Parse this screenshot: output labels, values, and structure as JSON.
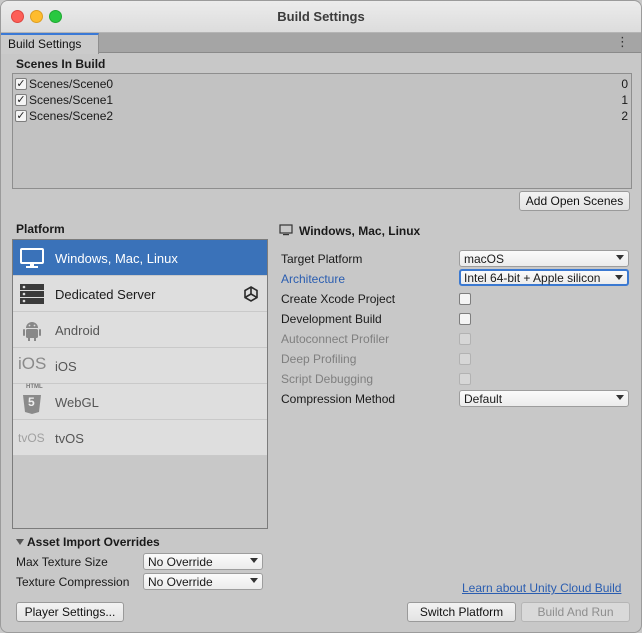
{
  "window": {
    "title": "Build Settings"
  },
  "tab": {
    "label": "Build Settings"
  },
  "scenes": {
    "header": "Scenes In Build",
    "items": [
      {
        "name": "Scenes/Scene0",
        "index": "0",
        "checked": true
      },
      {
        "name": "Scenes/Scene1",
        "index": "1",
        "checked": true
      },
      {
        "name": "Scenes/Scene2",
        "index": "2",
        "checked": true
      }
    ],
    "add_open_scenes_label": "Add Open Scenes"
  },
  "platform": {
    "header": "Platform",
    "items": [
      {
        "label": "Windows, Mac, Linux",
        "icon": "monitor-icon",
        "selected": true
      },
      {
        "label": "Dedicated Server",
        "icon": "server-icon",
        "selected": false,
        "badge": "unity-icon"
      },
      {
        "label": "Android",
        "icon": "android-icon",
        "selected": false
      },
      {
        "label": "iOS",
        "icon": "ios-icon",
        "icon_text": "iOS",
        "selected": false
      },
      {
        "label": "WebGL",
        "icon": "html5-icon",
        "icon_text": "5",
        "icon_caption": "HTML",
        "selected": false
      },
      {
        "label": "tvOS",
        "icon": "tvos-icon",
        "icon_text": "tvOS",
        "selected": false
      }
    ]
  },
  "settings": {
    "title": "Windows, Mac, Linux",
    "target_platform_label": "Target Platform",
    "target_platform_value": "macOS",
    "architecture_label": "Architecture",
    "architecture_value": "Intel 64-bit + Apple silicon",
    "create_xcode_label": "Create Xcode Project",
    "development_build_label": "Development Build",
    "autoconnect_profiler_label": "Autoconnect Profiler",
    "deep_profiling_label": "Deep Profiling",
    "script_debugging_label": "Script Debugging",
    "compression_method_label": "Compression Method",
    "compression_method_value": "Default"
  },
  "asset_import": {
    "header": "Asset Import Overrides",
    "max_texture_size_label": "Max Texture Size",
    "max_texture_size_value": "No Override",
    "texture_compression_label": "Texture Compression",
    "texture_compression_value": "No Override"
  },
  "footer": {
    "cloud_build_link": "Learn about Unity Cloud Build",
    "player_settings_label": "Player Settings...",
    "switch_platform_label": "Switch Platform",
    "build_and_run_label": "Build And Run"
  },
  "colors": {
    "selected_bg": "#3a72b9",
    "link": "#2a5db0",
    "tab_accent": "#3a79d6"
  }
}
